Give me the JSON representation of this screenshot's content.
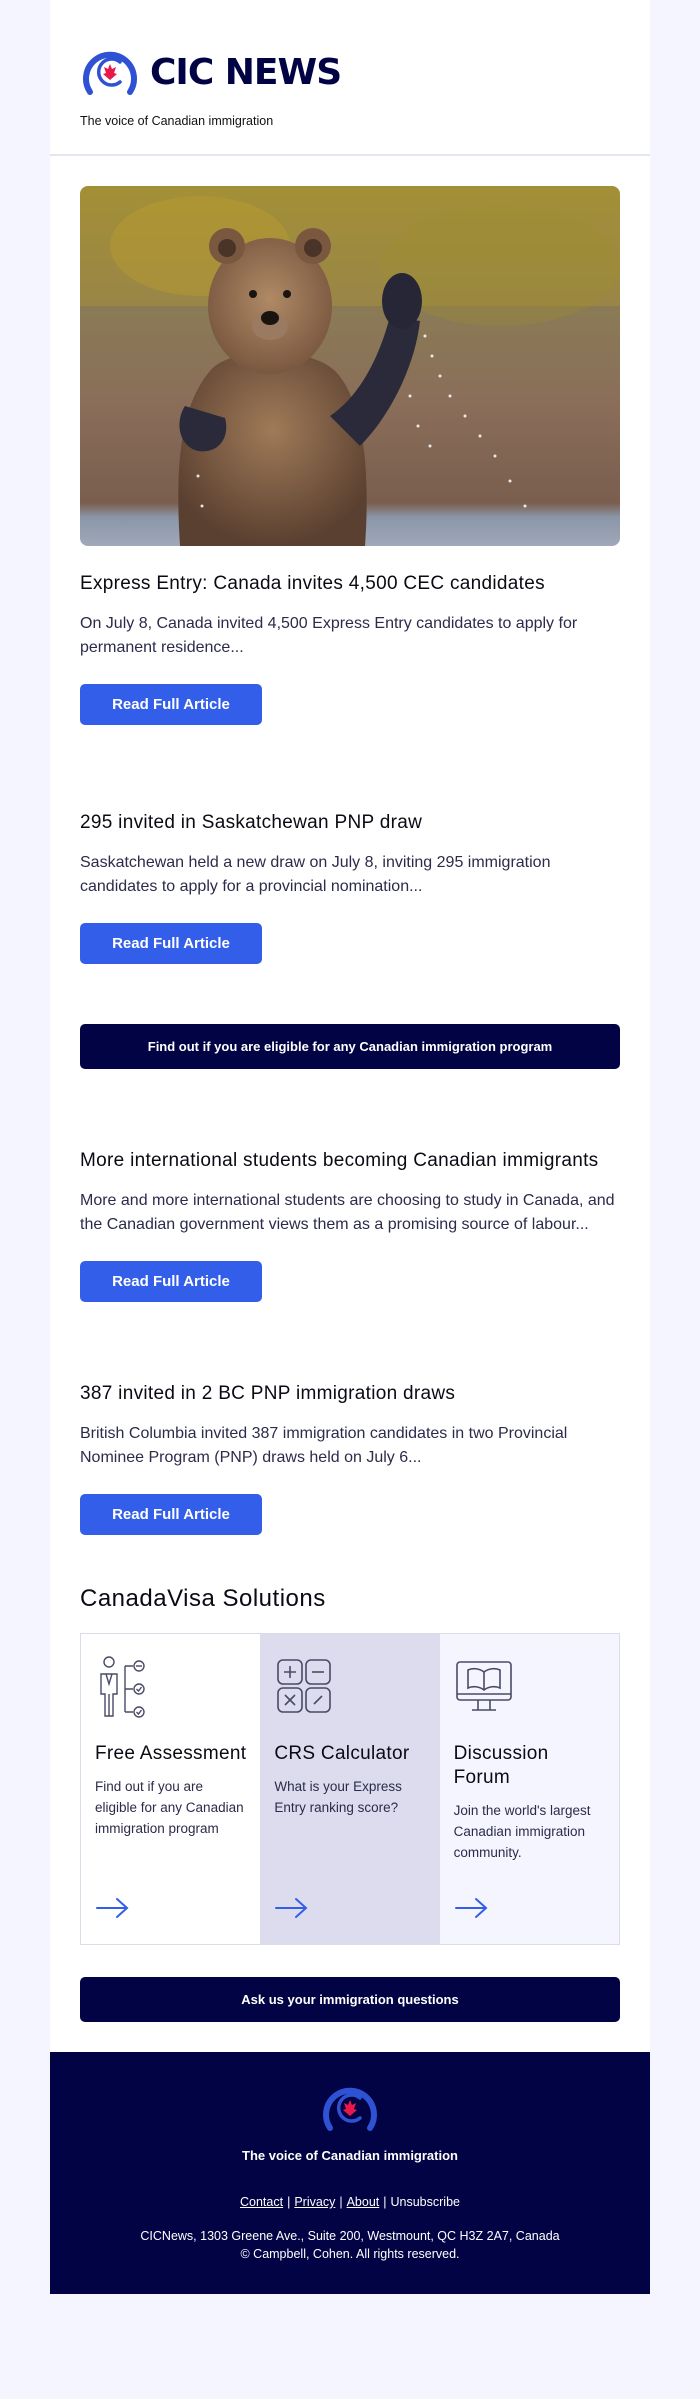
{
  "header": {
    "brand": "CIC NEWS",
    "tagline": "The voice of Canadian immigration"
  },
  "hero": {
    "image_alt": "Grizzly bear standing in a river waving its paw"
  },
  "articles": [
    {
      "title": "Express Entry: Canada invites 4,500 CEC candidates",
      "excerpt": "On July 8, Canada invited 4,500 Express Entry candidates to apply for permanent residence...",
      "button": "Read Full Article"
    },
    {
      "title": "295 invited in Saskatchewan PNP draw",
      "excerpt": "Saskatchewan held a new draw on July 8, inviting 295 immigration candidates to apply for a provincial nomination...",
      "button": "Read Full Article"
    },
    {
      "title": "More international students becoming Canadian immigrants",
      "excerpt": "More and more international students are choosing to study in Canada, and the Canadian government views them as a promising source of labour...",
      "button": "Read Full Article"
    },
    {
      "title": "387 invited in 2 BC PNP immigration draws",
      "excerpt": "British Columbia invited 387 immigration candidates in two Provincial Nominee Program (PNP) draws held on July 6...",
      "button": "Read Full Article"
    }
  ],
  "eligibility_cta": "Find out if you are eligible for any Canadian immigration program",
  "solutions": {
    "title": "CanadaVisa Solutions",
    "cards": [
      {
        "icon": "assessment-checklist-icon",
        "title": "Free Assessment",
        "description": "Find out if you are eligible for any Canadian immigration program"
      },
      {
        "icon": "calculator-icon",
        "title": "CRS Calculator",
        "description": "What is your Express Entry ranking score?"
      },
      {
        "icon": "forum-monitor-book-icon",
        "title": "Discussion Forum",
        "description": "Join the world's largest Canadian immigration community."
      }
    ]
  },
  "ask_cta": "Ask us your immigration questions",
  "footer": {
    "tagline": "The voice of Canadian immigration",
    "links": [
      "Contact",
      "Privacy",
      "About",
      "Unsubscribe"
    ],
    "separator": "|",
    "address": "CICNews, 1303 Greene Ave., Suite 200, Westmount, QC H3Z 2A7, Canada",
    "copyright": "© Campbell, Cohen. All rights reserved."
  },
  "colors": {
    "brand_navy": "#020344",
    "accent_blue": "#335eea",
    "maple_red": "#e8194a",
    "page_background": "#f5f5ff"
  }
}
